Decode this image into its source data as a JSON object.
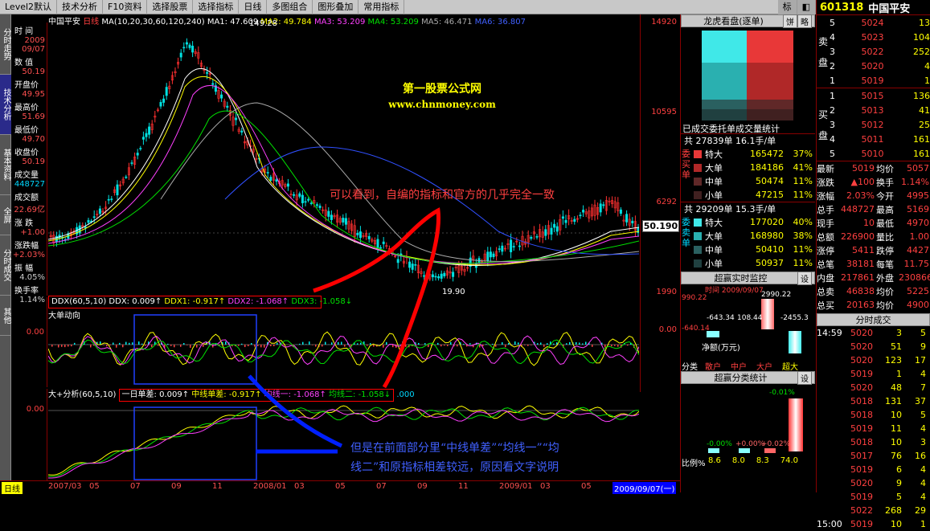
{
  "toolbar": {
    "items": [
      "Level2默认",
      "技术分析",
      "F10资料",
      "选择股票",
      "选择指标",
      "日线",
      "多图组合",
      "图形叠加",
      "常用指标"
    ]
  },
  "left_tabs": [
    "分时走势",
    "技术分析",
    "基本资料",
    "全屏",
    "分时成交",
    "其他"
  ],
  "info": {
    "rows": [
      {
        "l": "时 间",
        "v": "2009"
      },
      {
        "l": "",
        "v": "09/07"
      },
      {
        "l": "数 值",
        "v": "50.19"
      },
      {
        "l": "开盘价",
        "v": "49.95"
      },
      {
        "l": "最高价",
        "v": "51.69"
      },
      {
        "l": "最低价",
        "v": "49.70"
      },
      {
        "l": "收盘价",
        "v": "50.19"
      },
      {
        "l": "成交量",
        "v": "448727"
      },
      {
        "l": "成交额",
        "v": "22.69亿"
      },
      {
        "l": "涨 跌",
        "v": "+1.00"
      },
      {
        "l": "涨跌幅",
        "v": "+2.03%"
      },
      {
        "l": "振 幅",
        "v": "4.05%"
      },
      {
        "l": "换手率",
        "v": "1.14%"
      }
    ]
  },
  "main_header": {
    "stock": "中国平安",
    "period": "日线",
    "ma_label": "MA(10,20,30,60,120,240)",
    "ma1": "MA1: 47.609",
    "ma2": "MA2: 49.784",
    "ma3": "MA3: 53.209",
    "ma4": "MA4: 53.209",
    "ma5": "MA5: 46.471",
    "ma6": "MA6: 36.807"
  },
  "price_axis": {
    "labels": [
      "14920",
      "10595",
      "6292",
      "1990"
    ],
    "current": "50.190",
    "high_mark": "149.28",
    "low_mark": "19.90"
  },
  "watermark": {
    "line1": "第一股票公式网",
    "line2": "www.chnmoney.com"
  },
  "annotation1": "可以看到，自编的指标和官方的几乎完全一致",
  "annotation2_line1": "但是在前面部分里“中线单差”“均线一”“均",
  "annotation2_line2": "线二”和原指标相差较远，原因看文字说明",
  "ddx_header": {
    "name": "DDX(60,5,10)",
    "ddx": "DDX: 0.009↑",
    "ddx1": "DDX1: -0.917↑",
    "ddx2": "DDX2: -1.068↑",
    "ddx3": "DDX3: -1.058↓"
  },
  "sub1_title": "大单动向",
  "sub1_axis": "0.00",
  "sub2_header": {
    "name": "大+分析(60,5,10)",
    "a": "一日单差: 0.009↑",
    "b": "中线单差: -0.917↑",
    "c": "均线一: -1.068↑",
    "d": "均线二: -1.058↓",
    "e": ".000"
  },
  "sub2_axis": "0.00",
  "time_axis": {
    "label": "日线",
    "ticks": [
      "2007/03",
      "05",
      "07",
      "09",
      "11",
      "2008/01",
      "03",
      "05",
      "07",
      "09",
      "11",
      "2009/01",
      "03",
      "05"
    ],
    "end": "2009/09/07(一)"
  },
  "dragon": {
    "title": "龙虎看盘(逐单)",
    "btn1": "饼",
    "btn2": "略",
    "caption": "已成交委托单成交量统计"
  },
  "buy_stats": {
    "header": "共 27839单 16.1手/单",
    "side": "委买单",
    "rows": [
      {
        "n": "特大",
        "v": "165472",
        "p": "37%"
      },
      {
        "n": "大单",
        "v": "184186",
        "p": "41%"
      },
      {
        "n": "中单",
        "v": "50474",
        "p": "11%"
      },
      {
        "n": "小单",
        "v": "47215",
        "p": "11%"
      }
    ]
  },
  "sell_stats": {
    "header": "共 29209单 15.3手/单",
    "side": "委卖单",
    "rows": [
      {
        "n": "特大",
        "v": "177020",
        "p": "40%"
      },
      {
        "n": "大单",
        "v": "168980",
        "p": "38%"
      },
      {
        "n": "中单",
        "v": "50410",
        "p": "11%"
      },
      {
        "n": "小单",
        "v": "50937",
        "p": "11%"
      }
    ]
  },
  "realtime": {
    "title": "超赢实时监控",
    "btn": "设",
    "time": "时间 2009/09/07",
    "v1": "990.22",
    "v2": "2990.22",
    "v3": "-643.34",
    "v4": "108.44",
    "v5": "-2455.3",
    "v6": "-640.14",
    "label": "净额(万元)",
    "cats": [
      "散户",
      "中户",
      "大户",
      "超大"
    ],
    "cat_label": "分类"
  },
  "classify": {
    "title": "超赢分类统计",
    "btn": "设",
    "pct1": "-0.01%",
    "pcts": [
      "-0.00%",
      "+0.00%",
      "+0.02%"
    ],
    "vals": [
      "8.6",
      "8.0",
      "8.3",
      "74.0"
    ],
    "footer": "比例%"
  },
  "quote": {
    "code": "601318",
    "name": "中国平安",
    "sell": [
      {
        "n": "5",
        "p": "5024",
        "v": "13"
      },
      {
        "n": "4",
        "p": "5023",
        "v": "104"
      },
      {
        "n": "3",
        "p": "5022",
        "v": "252"
      },
      {
        "n": "2",
        "p": "5020",
        "v": "4"
      },
      {
        "n": "1",
        "p": "5019",
        "v": "1"
      }
    ],
    "buy": [
      {
        "n": "1",
        "p": "5015",
        "v": "136"
      },
      {
        "n": "2",
        "p": "5013",
        "v": "41"
      },
      {
        "n": "3",
        "p": "5012",
        "v": "25"
      },
      {
        "n": "4",
        "p": "5011",
        "v": "161"
      },
      {
        "n": "5",
        "p": "5010",
        "v": "161"
      }
    ],
    "sell_label": "卖盘",
    "buy_label": "买盘",
    "stats": [
      [
        "最新",
        "5019",
        "均价",
        "5057"
      ],
      [
        "涨跌",
        "▲100",
        "换手",
        "1.14%"
      ],
      [
        "涨幅",
        "2.03%",
        "今开",
        "4995"
      ],
      [
        "总手",
        "448727",
        "最高",
        "5169"
      ],
      [
        "现手",
        "10",
        "最低",
        "4970"
      ],
      [
        "总额",
        "226900",
        "量比",
        "1.00"
      ],
      [
        "涨停",
        "5411",
        "跌停",
        "4427"
      ],
      [
        "总笔",
        "38181",
        "每笔",
        "11.75"
      ],
      [
        "内盘",
        "217861",
        "外盘",
        "230866"
      ],
      [
        "总卖",
        "46838",
        "均价",
        "5225"
      ],
      [
        "总买",
        "20163",
        "均价",
        "4900"
      ]
    ],
    "trades_title": "分时成交",
    "trades": [
      [
        "14:59",
        "5020",
        "3",
        "5"
      ],
      [
        "5020",
        "51",
        "9"
      ],
      [
        "5020",
        "123",
        "17"
      ],
      [
        "5019",
        "1",
        "4"
      ],
      [
        "5020",
        "48",
        "7"
      ],
      [
        "5018",
        "131",
        "37"
      ],
      [
        "5018",
        "10",
        "5"
      ],
      [
        "5019",
        "11",
        "4"
      ],
      [
        "5018",
        "10",
        "3"
      ],
      [
        "5017",
        "76",
        "16"
      ],
      [
        "5019",
        "6",
        "4"
      ],
      [
        "5020",
        "9",
        "4"
      ],
      [
        "5019",
        "5",
        "4"
      ],
      [
        "5022",
        "268",
        "29"
      ],
      [
        "15:00",
        "5019",
        "10",
        "1"
      ]
    ]
  }
}
